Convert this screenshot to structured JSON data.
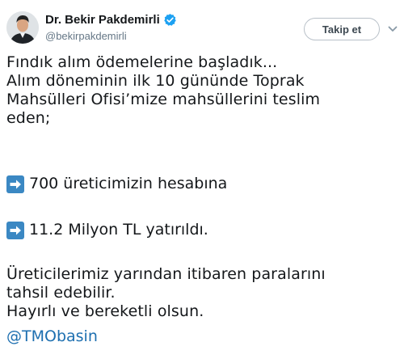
{
  "author": {
    "display_name": "Dr. Bekir Pakdemirli",
    "handle": "@bekirpakdemirli",
    "verified": true,
    "avatar_icon": "user-avatar"
  },
  "follow_button": {
    "label": "Takip et"
  },
  "tweet": {
    "paragraph1": [
      "Fındık alım ödemelerine başladık...",
      "Alım döneminin ilk 10 gününde Toprak",
      "Mahsülleri Ofisi’mize mahsüllerini teslim",
      "eden;"
    ],
    "bullets": [
      {
        "icon": "right-arrow-emoji",
        "text": "700 üreticimizin hesabına"
      },
      {
        "icon": "right-arrow-emoji",
        "text": "11.2 Milyon TL yatırıldı."
      }
    ],
    "paragraph2": [
      "Üreticilerimiz yarından itibaren paralarını",
      "tahsil edebilir.",
      "Hayırlı ve bereketli olsun."
    ],
    "mention": "@TMObasin"
  },
  "colors": {
    "text": "#14171a",
    "secondary": "#657786",
    "link": "#1d6fb0",
    "verified_badge": "#1da1f2",
    "arrow_emoji_bg": "#3b88c3"
  }
}
